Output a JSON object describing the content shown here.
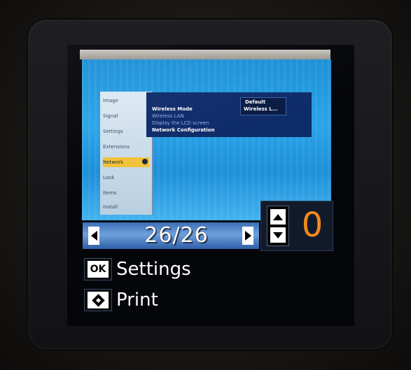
{
  "preview": {
    "sidebar_items": [
      "Image",
      "Signal",
      "Settings",
      "Extensions",
      "Network",
      "Look",
      "Items",
      "Install"
    ],
    "selected_index": 4,
    "panel_rows": [
      {
        "text": "Wireless Mode",
        "dim": false
      },
      {
        "text": "Wireless LAN",
        "dim": true
      },
      {
        "text": "Display the LCD screen",
        "dim": true
      },
      {
        "text": "Network Configuration",
        "dim": false
      }
    ],
    "panel_box_top": "Default",
    "panel_box_bottom": "Wireless L..."
  },
  "navigation": {
    "counter": "26/26"
  },
  "copies": {
    "value": "0",
    "value_color": "#f08a1c"
  },
  "options": [
    {
      "key": "OK",
      "label": "Settings"
    },
    {
      "key": "diamond-start-icon",
      "label": "Print"
    }
  ]
}
